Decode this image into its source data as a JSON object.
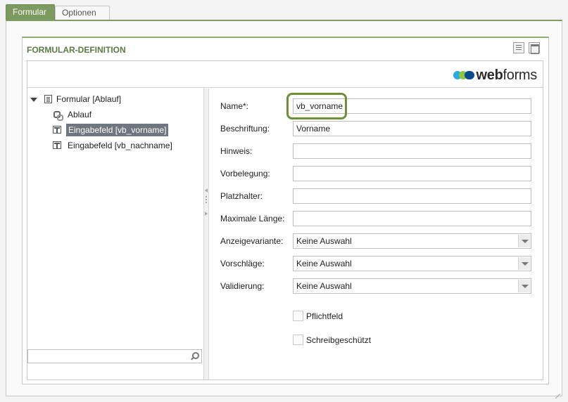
{
  "tabs": [
    {
      "label": "Formular",
      "active": true
    },
    {
      "label": "Optionen",
      "active": false
    }
  ],
  "panel": {
    "title": "FORMULAR-DEFINITION",
    "icons": [
      "document-icon",
      "window-icon"
    ]
  },
  "logo": {
    "prefix": "web",
    "suffix": "forms"
  },
  "tree": {
    "root": "Formular [Ablauf]",
    "children": [
      {
        "label": "Ablauf",
        "icon": "flow-gear-icon",
        "selected": false
      },
      {
        "label": "Eingabefeld [vb_vorname]",
        "icon": "input-field-icon",
        "selected": true
      },
      {
        "label": "Eingabefeld [vb_nachname]",
        "icon": "input-field-icon",
        "selected": false
      }
    ],
    "search_value": ""
  },
  "form": {
    "fields": [
      {
        "label": "Name*:",
        "value": "vb_vorname"
      },
      {
        "label": "Beschriftung:",
        "value": "Vorname"
      },
      {
        "label": "Hinweis:",
        "value": ""
      },
      {
        "label": "Vorbelegung:",
        "value": ""
      },
      {
        "label": "Platzhalter:",
        "value": ""
      },
      {
        "label": "Maximale Länge:",
        "value": ""
      }
    ],
    "selects": [
      {
        "label": "Anzeigevariante:",
        "value": "Keine Auswahl"
      },
      {
        "label": "Vorschläge:",
        "value": "Keine Auswahl"
      },
      {
        "label": "Validierung:",
        "value": "Keine Auswahl"
      }
    ],
    "checkboxes": [
      {
        "label": "Pflichtfeld",
        "checked": false
      },
      {
        "label": "Schreibgeschützt",
        "checked": false
      }
    ]
  },
  "colors": {
    "accent": "#7d9a61",
    "title": "#5d7a45",
    "selection": "#6e7780",
    "focus_ring": "#6f8e3a"
  }
}
